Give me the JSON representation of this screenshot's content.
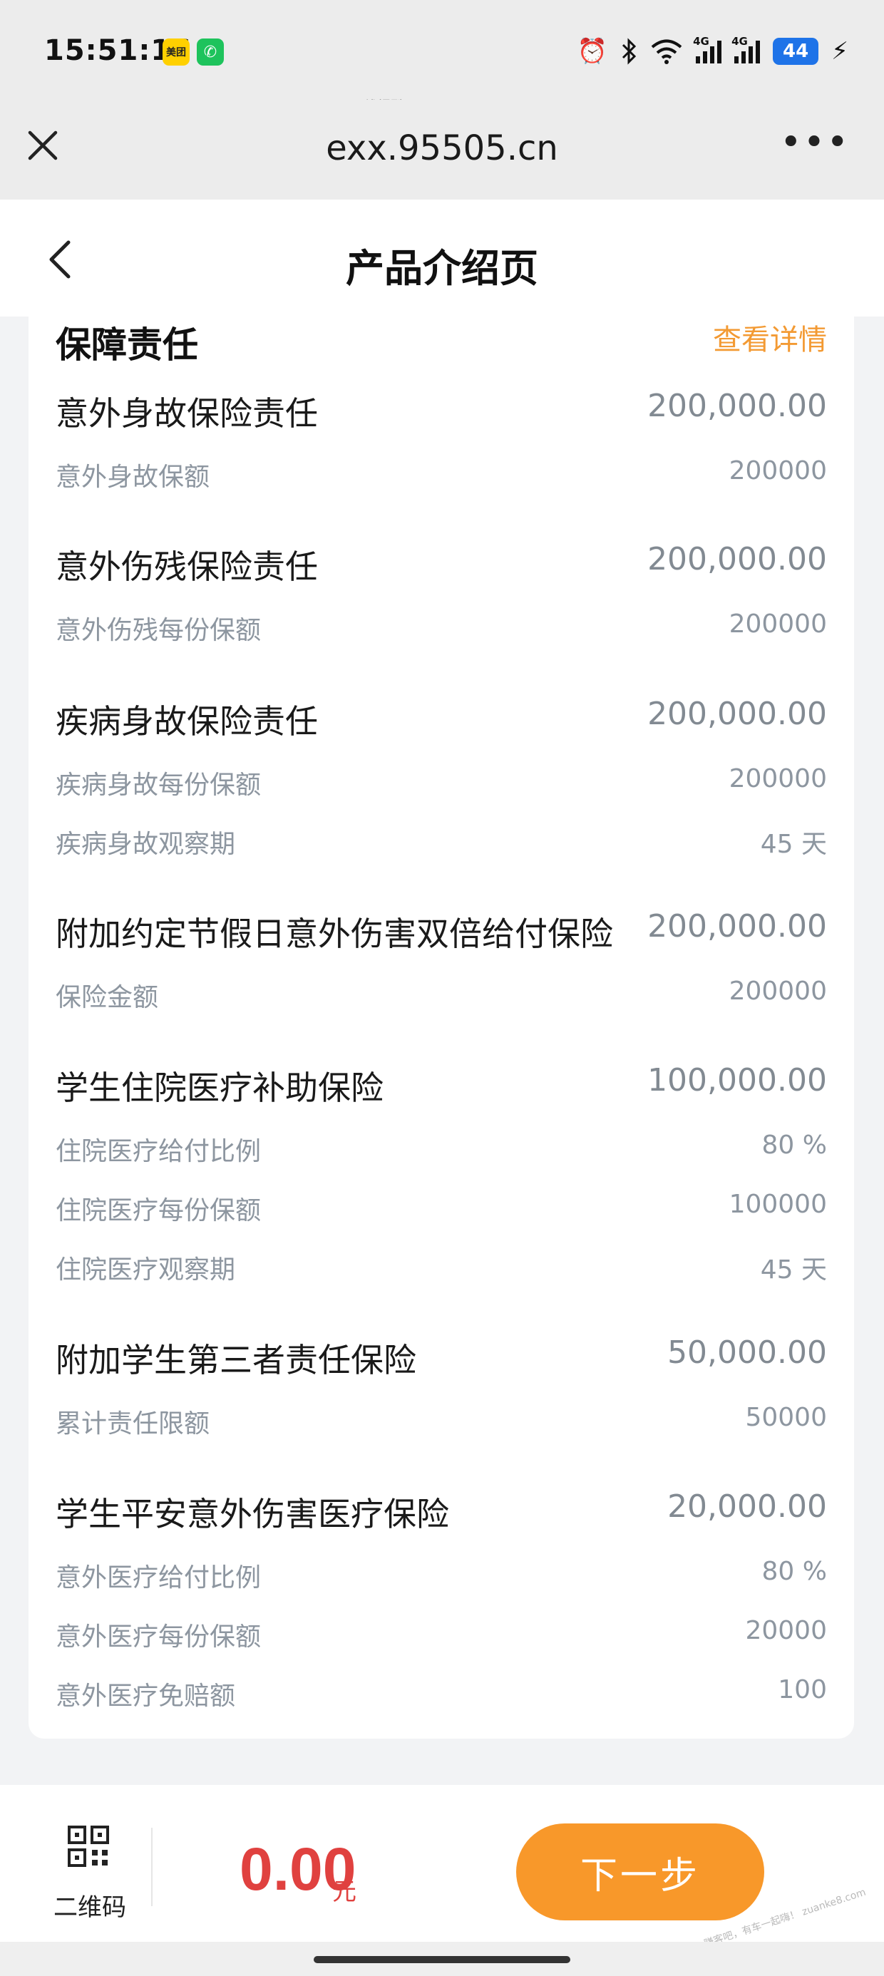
{
  "status_bar": {
    "time": "15:51:16",
    "app_badge_1": "美团",
    "app_badge_2": "✆",
    "network_1": "4G",
    "network_2": "4G",
    "battery": "44"
  },
  "watermark_top": "线报酷-new.xianbao.fun",
  "browser": {
    "url": "exx.95505.cn"
  },
  "header": {
    "title": "产品介绍页"
  },
  "section": {
    "title": "保障责任",
    "link": "查看详情"
  },
  "responsibilities": [
    {
      "name": "意外身故保险责任",
      "amount": "200,000.00",
      "items": [
        {
          "label": "意外身故保额",
          "value": "200000"
        }
      ]
    },
    {
      "name": "意外伤残保险责任",
      "amount": "200,000.00",
      "items": [
        {
          "label": "意外伤残每份保额",
          "value": "200000"
        }
      ]
    },
    {
      "name": "疾病身故保险责任",
      "amount": "200,000.00",
      "items": [
        {
          "label": "疾病身故每份保额",
          "value": "200000"
        },
        {
          "label": "疾病身故观察期",
          "value": "45 天"
        }
      ]
    },
    {
      "name": "附加约定节假日意外伤害双倍给付保险",
      "amount": "200,000.00",
      "items": [
        {
          "label": "保险金额",
          "value": "200000"
        }
      ]
    },
    {
      "name": "学生住院医疗补助保险",
      "amount": "100,000.00",
      "items": [
        {
          "label": "住院医疗给付比例",
          "value": "80 %"
        },
        {
          "label": "住院医疗每份保额",
          "value": "100000"
        },
        {
          "label": "住院医疗观察期",
          "value": "45 天"
        }
      ]
    },
    {
      "name": "附加学生第三者责任保险",
      "amount": "50,000.00",
      "items": [
        {
          "label": "累计责任限额",
          "value": "50000"
        }
      ]
    },
    {
      "name": "学生平安意外伤害医疗保险",
      "amount": "20,000.00",
      "items": [
        {
          "label": "意外医疗给付比例",
          "value": "80 %"
        },
        {
          "label": "意外医疗每份保额",
          "value": "20000"
        },
        {
          "label": "意外医疗免赔额",
          "value": "100"
        }
      ]
    }
  ],
  "bottom_bar": {
    "qr_label": "二维码",
    "price": "0.00",
    "price_unit": "元",
    "next_label": "下一步"
  },
  "watermark_bottom": "赚客吧，有车一起嗨！ zuanke8.com"
}
